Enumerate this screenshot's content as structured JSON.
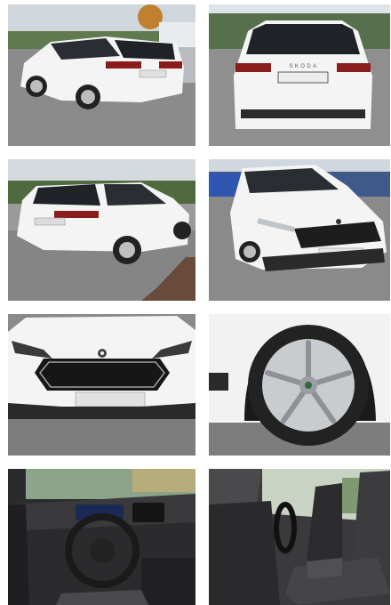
{
  "gallery": {
    "photos": [
      {
        "id": 1,
        "icon": "car-rear-three-quarter-photo"
      },
      {
        "id": 2,
        "icon": "car-rear-photo"
      },
      {
        "id": 3,
        "icon": "car-side-rear-photo"
      },
      {
        "id": 4,
        "icon": "car-front-three-quarter-photo"
      },
      {
        "id": 5,
        "icon": "car-front-closeup-photo"
      },
      {
        "id": 6,
        "icon": "wheel-photo"
      },
      {
        "id": 7,
        "icon": "dashboard-photo"
      },
      {
        "id": 8,
        "icon": "front-seats-photo"
      }
    ],
    "badges": {
      "rear_badge": "SKODA"
    },
    "colors": {
      "car_body": "#f4f4f4",
      "asphalt": "#8e8e8e",
      "sky": "#dfe4ea",
      "interior": "#2b2b2d"
    }
  }
}
